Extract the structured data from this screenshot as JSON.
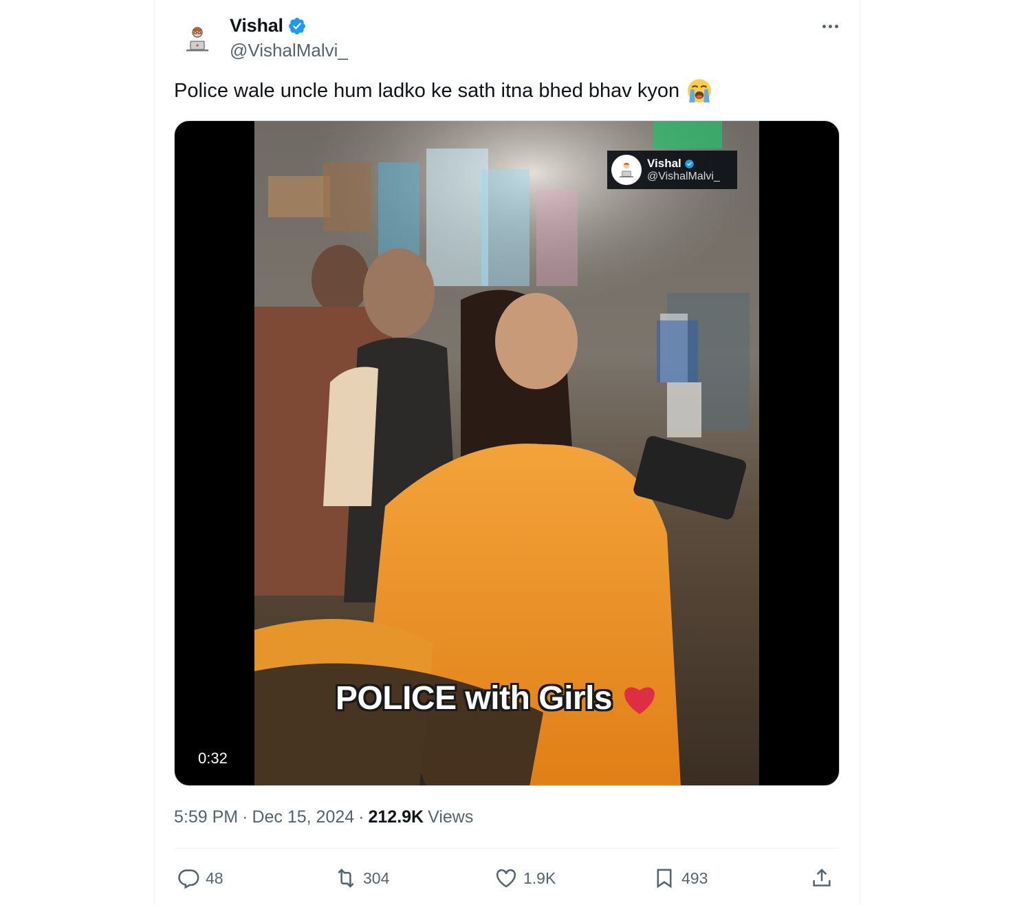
{
  "author": {
    "display_name": "Vishal",
    "handle": "@VishalMalvi_",
    "avatar_icon": "person-at-laptop-avatar-icon",
    "verified_color": "#1d9bf0"
  },
  "tweet": {
    "text": "Police wale uncle hum ladko ke sath itna bhed bhav kyon",
    "emoji": "loudly-crying-face-emoji"
  },
  "media": {
    "watermark_name": "Vishal",
    "watermark_handle": "@VishalMalvi_",
    "caption": "POLICE with Girls",
    "caption_emoji": "red-heart-emoji",
    "duration": "0:32"
  },
  "meta": {
    "time": "5:59 PM",
    "date": "Dec 15, 2024",
    "views_count": "212.9K",
    "views_label": "Views",
    "separator": "·"
  },
  "actions": {
    "replies": "48",
    "reposts": "304",
    "likes": "1.9K",
    "bookmarks": "493"
  }
}
